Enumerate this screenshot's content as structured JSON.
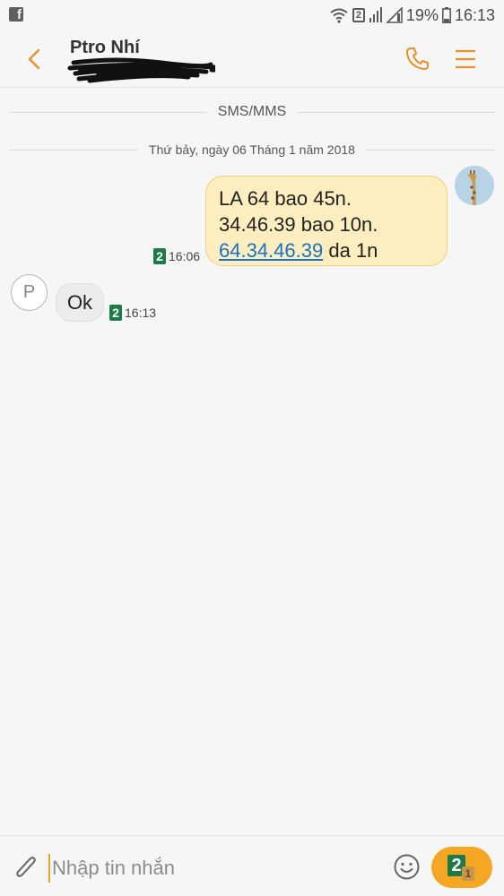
{
  "status_bar": {
    "app_icon": "facebook-icon",
    "sim_label": "2",
    "battery_percent": "19%",
    "time": "16:13"
  },
  "header": {
    "contact_name": "Ptro Nhí",
    "icons": {
      "back": "back-chevron-icon",
      "call": "phone-icon",
      "menu": "menu-icon"
    }
  },
  "conversation": {
    "channel_label": "SMS/MMS",
    "date_label": "Thứ bảy, ngày 06 Tháng 1 năm 2018",
    "messages": [
      {
        "direction": "outgoing",
        "lines": [
          "LA 64 bao 45n.",
          "34.46.39 bao 10n."
        ],
        "link_text": "64.34.46.39",
        "tail_text": " da 1n",
        "sim": "2",
        "time": "16:06"
      },
      {
        "direction": "incoming",
        "avatar_letter": "P",
        "text": "Ok",
        "sim": "2",
        "time": "16:13"
      }
    ]
  },
  "composer": {
    "placeholder": "Nhập tin nhắn",
    "send_sim_primary": "2",
    "send_sim_secondary": "1",
    "icons": {
      "attach": "paperclip-icon",
      "emoji": "emoji-icon"
    }
  },
  "colors": {
    "accent": "#e8902a",
    "outgoing_bubble": "#fdeebf",
    "incoming_bubble": "#ececec",
    "send_button": "#f5a623",
    "sim_badge": "#1e7a46",
    "link": "#1a6fc6"
  }
}
